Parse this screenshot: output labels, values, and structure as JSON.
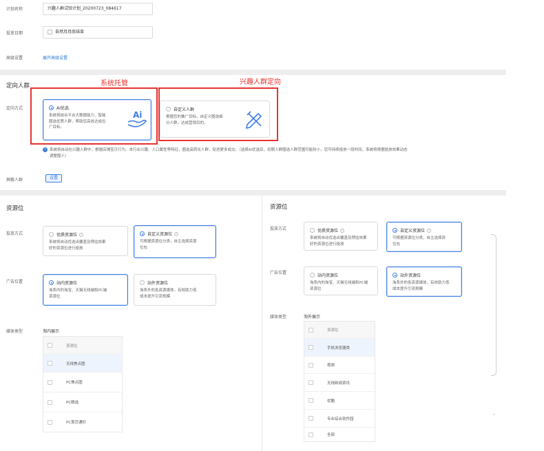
{
  "plan": {
    "name_label": "计划名称",
    "name_value": "兴趣人群试验计划_20200723_084617",
    "date_label": "投放日期",
    "date_checkbox": "自然月月底结束",
    "advanced_label": "高级设置",
    "advanced_link": "展开高级设置"
  },
  "targeting": {
    "section_title": "定向人群",
    "annot_left": "系统托管",
    "annot_right": "兴趣人群定向",
    "method_label": "定向方式",
    "cards": [
      {
        "title": "AI优选",
        "desc_lines": [
          "系统将结合平台大数据能力、智能",
          "圈选优质人群，帮助您高效达成拉",
          "广目标。"
        ],
        "selected": true,
        "icon": "ai-hand-icon"
      },
      {
        "title": "自定义人群",
        "desc_lines": [
          "根据您的推广目标，自定义圈选细",
          "分人群，达成营销目的。"
        ],
        "selected": false,
        "icon": "pencil-ruler-icon"
      }
    ],
    "note_lines": [
      "系统将自动在兴趣人群中，根据店铺宝贝行为、本行业兴趣、人口属性等特征，圈选高转化人群，促进更多成交。（选择AI优选后，初期人群圈选人群范围可能较小，您可持续投放一段时间，系统将根据投放效果动态",
      "调整圈人）"
    ],
    "shield_label": "屏蔽人群",
    "shield_button": "设置"
  },
  "resource_left": {
    "section_title": "资源位",
    "delivery_label": "投放方式",
    "delivery_cards": [
      {
        "title": "优质资源位",
        "desc_lines": [
          "系统将自动优选出覆盖及预估效果",
          "好的资源位进行投放"
        ],
        "selected": false
      },
      {
        "title": "自定义资源位",
        "desc_lines": [
          "可根据资源位分类，自主选择资源",
          "位包"
        ],
        "selected": true
      }
    ],
    "ad_label": "广告位置",
    "ad_cards": [
      {
        "title": "站内资源位",
        "desc_lines": [
          "淘系内的淘宝、天猫无线端和PC端",
          "资源位"
        ],
        "selected": true
      },
      {
        "title": "站外资源位",
        "desc_lines": [
          "淘系外的各资源媒体，有效助力低",
          "成本提升引流规模"
        ],
        "selected": false
      }
    ],
    "media_label": "媒体类型",
    "media_value": "淘内展示",
    "table_header": "资源位",
    "rows": [
      "无线焦点图",
      "PC焦点图",
      "PC精选",
      "PC首页通栏"
    ]
  },
  "resource_right": {
    "section_title": "资源位",
    "delivery_label": "投放方式",
    "delivery_cards": [
      {
        "title": "优质资源位",
        "desc_lines": [
          "系统将自动优选出覆盖及预估效果",
          "好的资源位进行投放"
        ],
        "selected": false
      },
      {
        "title": "自定义资源位",
        "desc_lines": [
          "可根据资源位分类，自主选择资",
          "位包"
        ],
        "selected": true
      }
    ],
    "ad_label": "广告位置",
    "ad_cards": [
      {
        "title": "站内资源位",
        "desc_lines": [
          "淘系内的淘宝、天猫无线端和PC端",
          "资源位"
        ],
        "selected": false
      },
      {
        "title": "站外资源位",
        "desc_lines": [
          "淘系外的各资源媒体，有效助力低",
          "成本提升引流规模"
        ],
        "selected": true
      }
    ],
    "media_label": "媒体类型",
    "media_value": "淘外展示",
    "table_header": "资源位",
    "rows": [
      "手机浏览器类",
      "视频",
      "无线新闻资讯",
      "优酷",
      "专业综合软件园",
      "全部"
    ]
  },
  "colors": {
    "accent": "#3e7de0",
    "annotation": "#e8322e",
    "divider": "#eeeeee"
  }
}
